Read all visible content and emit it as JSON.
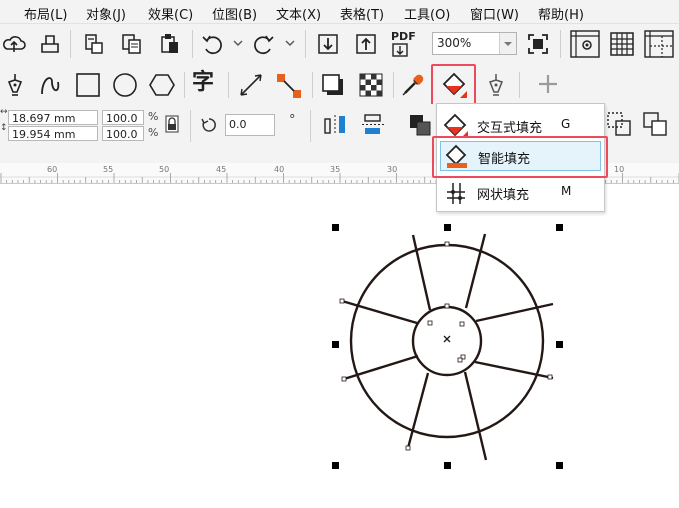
{
  "menubar": {
    "items": [
      "布局(L)",
      "对象(J)",
      "效果(C)",
      "位图(B)",
      "文本(X)",
      "表格(T)",
      "工具(O)",
      "窗口(W)",
      "帮助(H)"
    ]
  },
  "toolbar": {
    "pdf_label": "PDF",
    "zoom_value": "300%"
  },
  "propertybar": {
    "width_value": "18.697 mm",
    "height_value": "19.954 mm",
    "scale_x": "100.0",
    "scale_y": "100.0",
    "percent_x": "%",
    "percent_y": "%",
    "rotation_value": "0.0",
    "degree_symbol": "°"
  },
  "ruler": {
    "labels": [
      "60",
      "55",
      "50",
      "45",
      "40",
      "35",
      "30",
      "10"
    ]
  },
  "flyout": {
    "items": [
      {
        "label": "交互式填充",
        "shortcut": "G"
      },
      {
        "label": "智能填充",
        "shortcut": ""
      },
      {
        "label": "网状填充",
        "shortcut": "M"
      }
    ]
  },
  "colors": {
    "accent_red": "#ee4a5e",
    "selection_blue": "#e5f3fb",
    "tab_line": "#34a9cd",
    "drawing": "#231815"
  }
}
